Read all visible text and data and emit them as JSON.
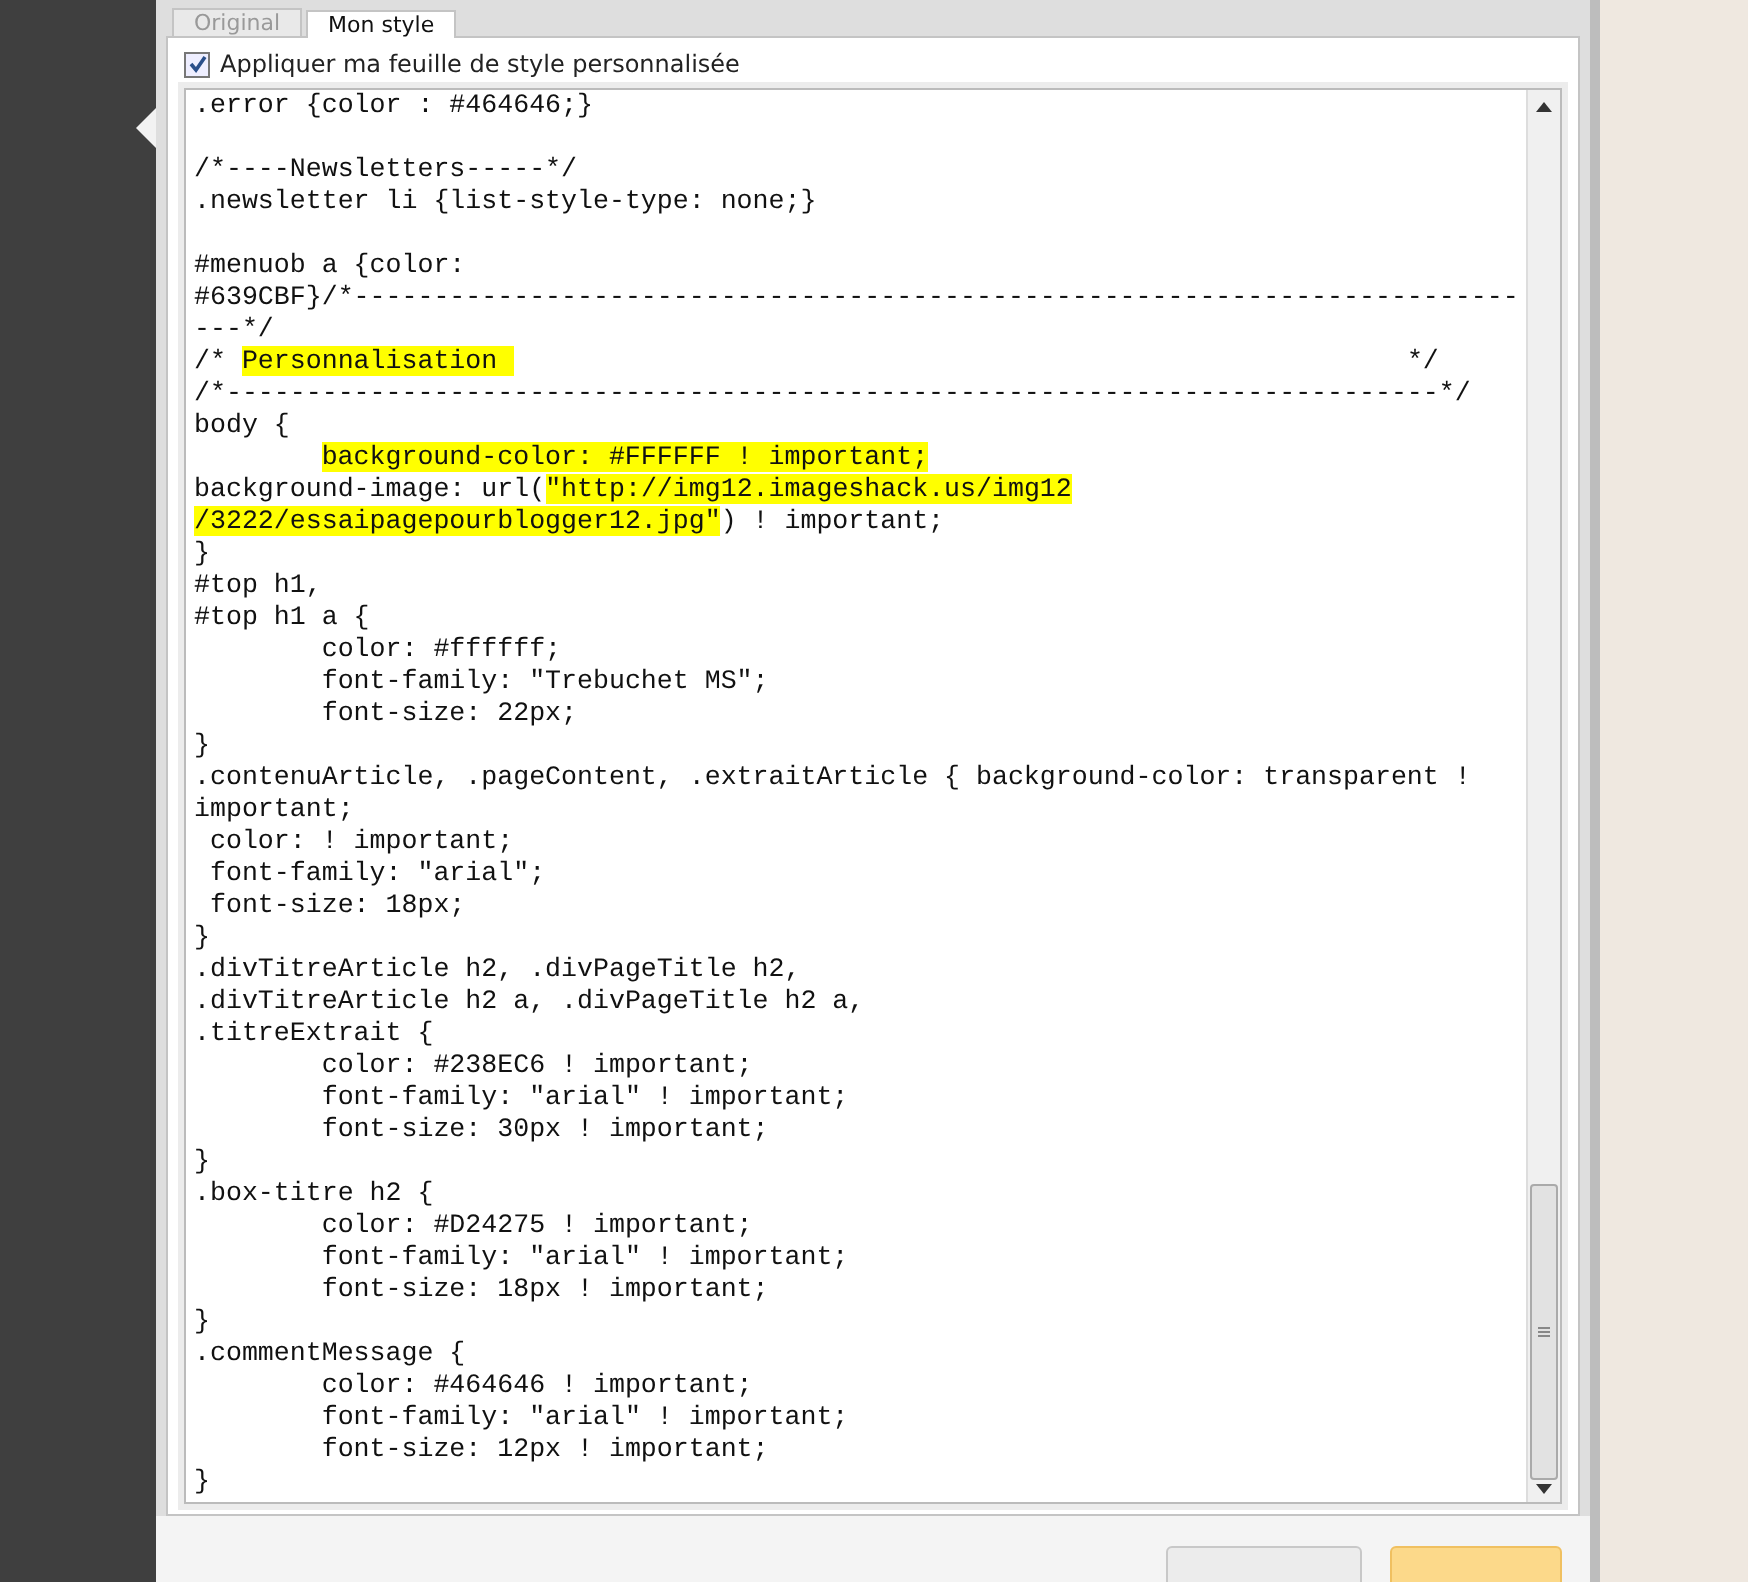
{
  "tabs": [
    {
      "label": "Original",
      "selected": false
    },
    {
      "label": "Mon style",
      "selected": true
    }
  ],
  "custom_stylesheet": {
    "label": "Appliquer ma feuille de style personnalisée",
    "checked": true
  },
  "editor": {
    "lines": [
      {
        "segments": [
          {
            "text": ".error {color : #464646;}",
            "highlighted": false
          }
        ]
      },
      {
        "blank_line_before": true,
        "segments": [
          {
            "text": "/*----Newsletters-----*/",
            "highlighted": false
          }
        ]
      },
      {
        "segments": [
          {
            "text": ".newsletter li {list-style-type: none;}",
            "highlighted": false
          }
        ]
      },
      {
        "blank_line_before": true,
        "segments": [
          {
            "text": "#menuob a {color:",
            "highlighted": false
          }
        ]
      },
      {
        "segments": [
          {
            "text": "#639CBF}/*-------------------------------------------------------------------------",
            "highlighted": false
          }
        ]
      },
      {
        "segments": [
          {
            "text": "---*/",
            "highlighted": false
          }
        ]
      },
      {
        "segments": [
          {
            "text": "/* ",
            "highlighted": false
          },
          {
            "text": "Personnalisation ",
            "highlighted": true
          },
          {
            "text": "                                                        */",
            "highlighted": false
          }
        ]
      },
      {
        "segments": [
          {
            "text": "/*----------------------------------------------------------------------------*/",
            "highlighted": false
          }
        ]
      },
      {
        "segments": [
          {
            "text": "body {",
            "highlighted": false
          }
        ]
      },
      {
        "indented": true,
        "segments": [
          {
            "text": "background-color: #FFFFFF ! important;",
            "highlighted": true
          }
        ]
      },
      {
        "segments": [
          {
            "text": "background-image: url(",
            "highlighted": false
          },
          {
            "text": "\"http://img12.imageshack.us/img12",
            "highlighted": true
          }
        ]
      },
      {
        "segments": [
          {
            "text": "/3222/essaipagepourblogger12.jpg\"",
            "highlighted": true
          },
          {
            "text": ") ! important;",
            "highlighted": false
          }
        ]
      },
      {
        "segments": [
          {
            "text": "}",
            "highlighted": false
          }
        ]
      },
      {
        "segments": [
          {
            "text": "#top h1,",
            "highlighted": false
          }
        ]
      },
      {
        "segments": [
          {
            "text": "#top h1 a {",
            "highlighted": false
          }
        ]
      },
      {
        "segments": [
          {
            "text": "        color: #ffffff;",
            "highlighted": false
          }
        ]
      },
      {
        "segments": [
          {
            "text": "        font-family: \"Trebuchet MS\";",
            "highlighted": false
          }
        ]
      },
      {
        "segments": [
          {
            "text": "        font-size: 22px;",
            "highlighted": false
          }
        ]
      },
      {
        "segments": [
          {
            "text": "}",
            "highlighted": false
          }
        ]
      },
      {
        "segments": [
          {
            "text": ".contenuArticle, .pageContent, .extraitArticle { background-color: transparent !",
            "highlighted": false
          }
        ]
      },
      {
        "segments": [
          {
            "text": "important;",
            "highlighted": false
          }
        ]
      },
      {
        "segments": [
          {
            "text": " color: ! important;",
            "highlighted": false
          }
        ]
      },
      {
        "segments": [
          {
            "text": " font-family: \"arial\";",
            "highlighted": false
          }
        ]
      },
      {
        "segments": [
          {
            "text": " font-size: 18px;",
            "highlighted": false
          }
        ]
      },
      {
        "segments": [
          {
            "text": "}",
            "highlighted": false
          }
        ]
      },
      {
        "segments": [
          {
            "text": ".divTitreArticle h2, .divPageTitle h2,",
            "highlighted": false
          }
        ]
      },
      {
        "segments": [
          {
            "text": ".divTitreArticle h2 a, .divPageTitle h2 a,",
            "highlighted": false
          }
        ]
      },
      {
        "segments": [
          {
            "text": ".titreExtrait {",
            "highlighted": false
          }
        ]
      },
      {
        "segments": [
          {
            "text": "        color: #238EC6 ! important;",
            "highlighted": false
          }
        ]
      },
      {
        "segments": [
          {
            "text": "        font-family: \"arial\" ! important;",
            "highlighted": false
          }
        ]
      },
      {
        "segments": [
          {
            "text": "        font-size: 30px ! important;",
            "highlighted": false
          }
        ]
      },
      {
        "segments": [
          {
            "text": "}",
            "highlighted": false
          }
        ]
      },
      {
        "segments": [
          {
            "text": ".box-titre h2 {",
            "highlighted": false
          }
        ]
      },
      {
        "segments": [
          {
            "text": "        color: #D24275 ! important;",
            "highlighted": false
          }
        ]
      },
      {
        "segments": [
          {
            "text": "        font-family: \"arial\" ! important;",
            "highlighted": false
          }
        ]
      },
      {
        "segments": [
          {
            "text": "        font-size: 18px ! important;",
            "highlighted": false
          }
        ]
      },
      {
        "segments": [
          {
            "text": "}",
            "highlighted": false
          }
        ]
      },
      {
        "segments": [
          {
            "text": ".commentMessage {",
            "highlighted": false
          }
        ]
      },
      {
        "segments": [
          {
            "text": "        color: #464646 ! important;",
            "highlighted": false
          }
        ]
      },
      {
        "segments": [
          {
            "text": "        font-family: \"arial\" ! important;",
            "highlighted": false
          }
        ]
      },
      {
        "segments": [
          {
            "text": "        font-size: 12px ! important;",
            "highlighted": false
          }
        ]
      },
      {
        "segments": [
          {
            "text": "}",
            "highlighted": false
          }
        ]
      }
    ]
  }
}
